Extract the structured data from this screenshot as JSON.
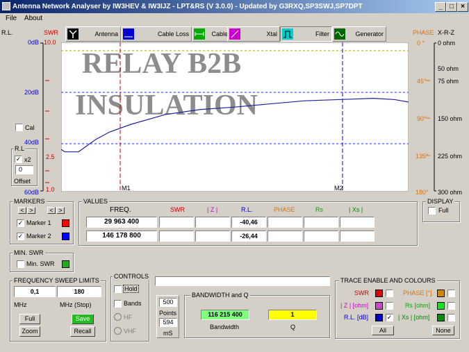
{
  "window": {
    "title": "Antenna Network Analyser by IW3HEV & IW3IJZ - LPT&RS (V 3.0.0) - Updated by G3RXQ,SP3SWJ,SP7DPT"
  },
  "menu": {
    "file": "File",
    "about": "About"
  },
  "tabs": [
    {
      "label": "Antenna"
    },
    {
      "label": "Cable Loss"
    },
    {
      "label": "Cable Length"
    },
    {
      "label": "Xtal"
    },
    {
      "label": "Filter"
    },
    {
      "label": "Generator"
    }
  ],
  "left_axis": {
    "rl_title": "R.L.",
    "swr_title": "SWR",
    "rl": [
      "0dB",
      "20dB",
      "40dB",
      "60dB"
    ],
    "swr": [
      "10.0",
      "2.5",
      "1.0"
    ]
  },
  "right_axis": {
    "phase_title": "PHASE",
    "xrz_title": "X-R-Z",
    "phase": [
      "0 °",
      "45°",
      "90°",
      "135°",
      "180°"
    ],
    "ohm": [
      "0 ohm",
      "50 ohm",
      "75 ohm",
      "150 ohm",
      "225 ohm",
      "300 ohm"
    ]
  },
  "overlay": {
    "line1": "RELAY B2B",
    "line2": "INSULATION"
  },
  "chart_data": {
    "type": "line",
    "x": [
      "M1",
      "M2"
    ],
    "y_axis": "R.L. (dB)",
    "ylim": [
      60,
      0
    ],
    "series": [
      {
        "color": "#2020a0",
        "points": [
          [
            0,
            43
          ],
          [
            1,
            44
          ],
          [
            5,
            44
          ],
          [
            6,
            43
          ],
          [
            8,
            41
          ],
          [
            10,
            39
          ],
          [
            14,
            36
          ],
          [
            20,
            33
          ],
          [
            30,
            29
          ],
          [
            40,
            27
          ],
          [
            50,
            26
          ],
          [
            70,
            23.5
          ],
          [
            90,
            22.5
          ],
          [
            96,
            23
          ],
          [
            100,
            24
          ]
        ]
      }
    ],
    "markers": [
      {
        "label": "M1",
        "pos": 17
      },
      {
        "label": "M2",
        "pos": 81
      }
    ]
  },
  "cal": {
    "label": "Cal"
  },
  "rl_group": {
    "title": "R.L",
    "x2": "x2",
    "offset_value": "0",
    "offset_label": "Offset"
  },
  "markers": {
    "title": "MARKERS",
    "m1": "Marker 1",
    "m2": "Marker 2",
    "m1_color": "#ff0000",
    "m2_color": "#0000ff",
    "lt": "<",
    "gt": ">"
  },
  "values": {
    "title": "VALUES",
    "headers": {
      "freq": "FREQ.",
      "swr": "SWR",
      "z": "| Z |",
      "rl": "R.L.",
      "phase": "PHASE",
      "rs": "Rs",
      "xs": "| Xs |"
    },
    "rows": [
      {
        "freq": "29 963 400",
        "rl": "-40,46"
      },
      {
        "freq": "146 178 800",
        "rl": "-26,44"
      }
    ]
  },
  "display": {
    "title": "DISPLAY",
    "full": "Full"
  },
  "minswr": {
    "title": "MIN. SWR",
    "label": "Min. SWR"
  },
  "sweep": {
    "title": "FREQUENCY SWEEP LIMITS",
    "start": "0,1",
    "stop": "180",
    "unit_start": "MHz",
    "unit_stop": "MHz (Stop)",
    "full": "Full",
    "save": "Save",
    "zoom": "Zoom",
    "recall": "Recall"
  },
  "controls": {
    "title": "CONTROLS",
    "hold": "Hold",
    "bands": "Bands",
    "hf": "HF",
    "vhf": "VHF"
  },
  "points": {
    "value": "500",
    "label": "Points",
    "ms_value": "594",
    "ms_label": "mS"
  },
  "bandwidth": {
    "title": "BANDWIDTH and Q",
    "bw": "116 215 400",
    "bw_label": "Bandwidth",
    "q": "1",
    "q_label": "Q"
  },
  "trace": {
    "title": "TRACE ENABLE AND COLOURS",
    "swr": "SWR",
    "z": "| Z | [ohm]",
    "rl": "R.L. [dB]",
    "phase": "PHASE [°]",
    "rs": "Rs [ohm]",
    "xs": "| Xs | [ohm]",
    "all": "All",
    "none": "None"
  }
}
